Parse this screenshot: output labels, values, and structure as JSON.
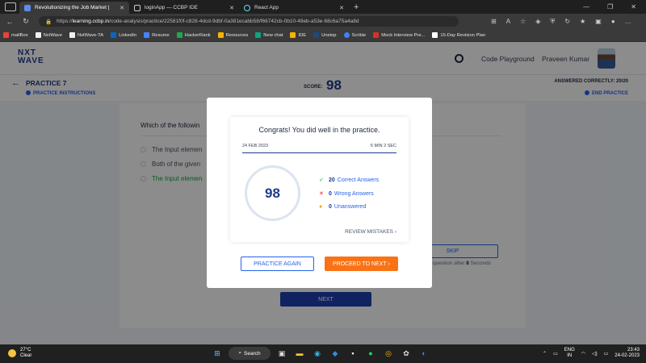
{
  "browser": {
    "tabs": [
      {
        "title": "Revolutionizing the Job Market |",
        "active": true
      },
      {
        "title": "loginApp — CCBP IDE",
        "active": false
      },
      {
        "title": "React App",
        "active": false
      }
    ],
    "url_prefix": "https://",
    "url_host": "learning.ccbp.in",
    "url_path": "/code-analysis/practice/22581f0f-c828-4dcd-9dbf-0a381ecabb58/f66742cb-0b10-48eb-a53e-68c6a75a4a8d",
    "bookmarks": [
      "mailBox",
      "NxtWave",
      "NxtWave-TA",
      "LinkedIn",
      "Resume",
      "HackerRank",
      "Resources",
      "New chat",
      "IDE",
      "Unstop",
      "Scribie",
      "Mock Interview Pre...",
      "15-Day Revision Plan"
    ]
  },
  "header": {
    "logo_line1": "NXT",
    "logo_line2": "WAVE",
    "playground": "Code Playground",
    "user_name": "Praveen Kumar"
  },
  "practice": {
    "title": "PRACTICE 7",
    "instructions": "PRACTICE INSTRUCTIONS",
    "score_label": "SCORE:",
    "score": "98",
    "answered": "ANSWERED CORRECTLY: 20/20",
    "end": "END PRACTICE"
  },
  "question": {
    "text": "Which of the followin",
    "options": [
      "The Input elemen",
      "Both of the given",
      "The Input elemen"
    ],
    "skip_label": "SKIP",
    "skip_note_pre": "question after ",
    "skip_seconds": "8",
    "skip_note_post": " Seconds",
    "next_label": "NEXT"
  },
  "modal": {
    "title": "Congrats! You did well in the practice.",
    "date": "24 FEB 2023",
    "duration": "6 MIN 2 SEC",
    "score": "98",
    "correct_count": "20",
    "correct_label": "Correct Answers",
    "wrong_count": "0",
    "wrong_label": "Wrong Answers",
    "unanswered_count": "0",
    "unanswered_label": "Unanswered",
    "review": "REVIEW MISTAKES",
    "practice_again": "PRACTICE AGAIN",
    "proceed": "PROCEED TO NEXT"
  },
  "taskbar": {
    "temp": "27°C",
    "weather": "Clear",
    "search": "Search",
    "lang1": "ENG",
    "lang2": "IN",
    "time": "23:43",
    "date": "24-02-2023"
  },
  "colors": {
    "brand": "#1e3a8a",
    "accent": "#2563eb",
    "orange": "#f97316",
    "correct": "#16a34a",
    "wrong": "#dc2626",
    "unanswered": "#f59e0b"
  }
}
